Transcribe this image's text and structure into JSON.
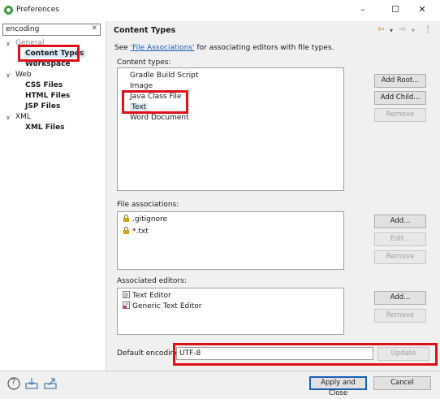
{
  "window": {
    "title": "Preferences",
    "minimize_glyph": "–",
    "maximize_glyph": "☐",
    "close_glyph": "✕"
  },
  "filter": {
    "value": "encoding",
    "clear_glyph": "✕"
  },
  "tree": {
    "general": "General",
    "content_types": "Content Types",
    "workspace": "Workspace",
    "web": "Web",
    "css_files": "CSS Files",
    "html_files": "HTML Files",
    "jsp_files": "JSP Files",
    "xml": "XML",
    "xml_files": "XML Files",
    "expanded_glyph": "∨"
  },
  "page": {
    "title": "Content Types",
    "desc_prefix": "See ",
    "desc_link": "'File Associations'",
    "desc_suffix": " for associating editors with file types.",
    "nav_back": "⇦",
    "nav_back_menu": "▾",
    "nav_fwd": "⇨",
    "nav_fwd_menu": "▾",
    "nav_more": "⋮"
  },
  "content_types": {
    "label": "Content types:",
    "items": [
      "Gradle Build Script",
      "Image",
      "Java Class File",
      "Text",
      "Word Document"
    ],
    "text_expander": "›",
    "buttons": {
      "add_root": "Add Root...",
      "add_child": "Add Child...",
      "remove": "Remove"
    }
  },
  "file_associations": {
    "label": "File associations:",
    "items": [
      ".gitignore",
      "*.txt"
    ],
    "buttons": {
      "add": "Add...",
      "edit": "Edit...",
      "remove": "Remove"
    }
  },
  "associated_editors": {
    "label": "Associated editors:",
    "items": [
      "Text Editor",
      "Generic Text Editor"
    ],
    "buttons": {
      "add": "Add...",
      "remove": "Remove"
    }
  },
  "encoding": {
    "label": "Default encoding:",
    "value": "UTF-8",
    "update": "Update"
  },
  "footer": {
    "apply_close": "Apply and Close",
    "cancel": "Cancel",
    "help_glyph": "?"
  },
  "colors": {
    "highlight": "#e0101a",
    "link": "#1a5fb4",
    "panel": "#f0f0f0"
  }
}
